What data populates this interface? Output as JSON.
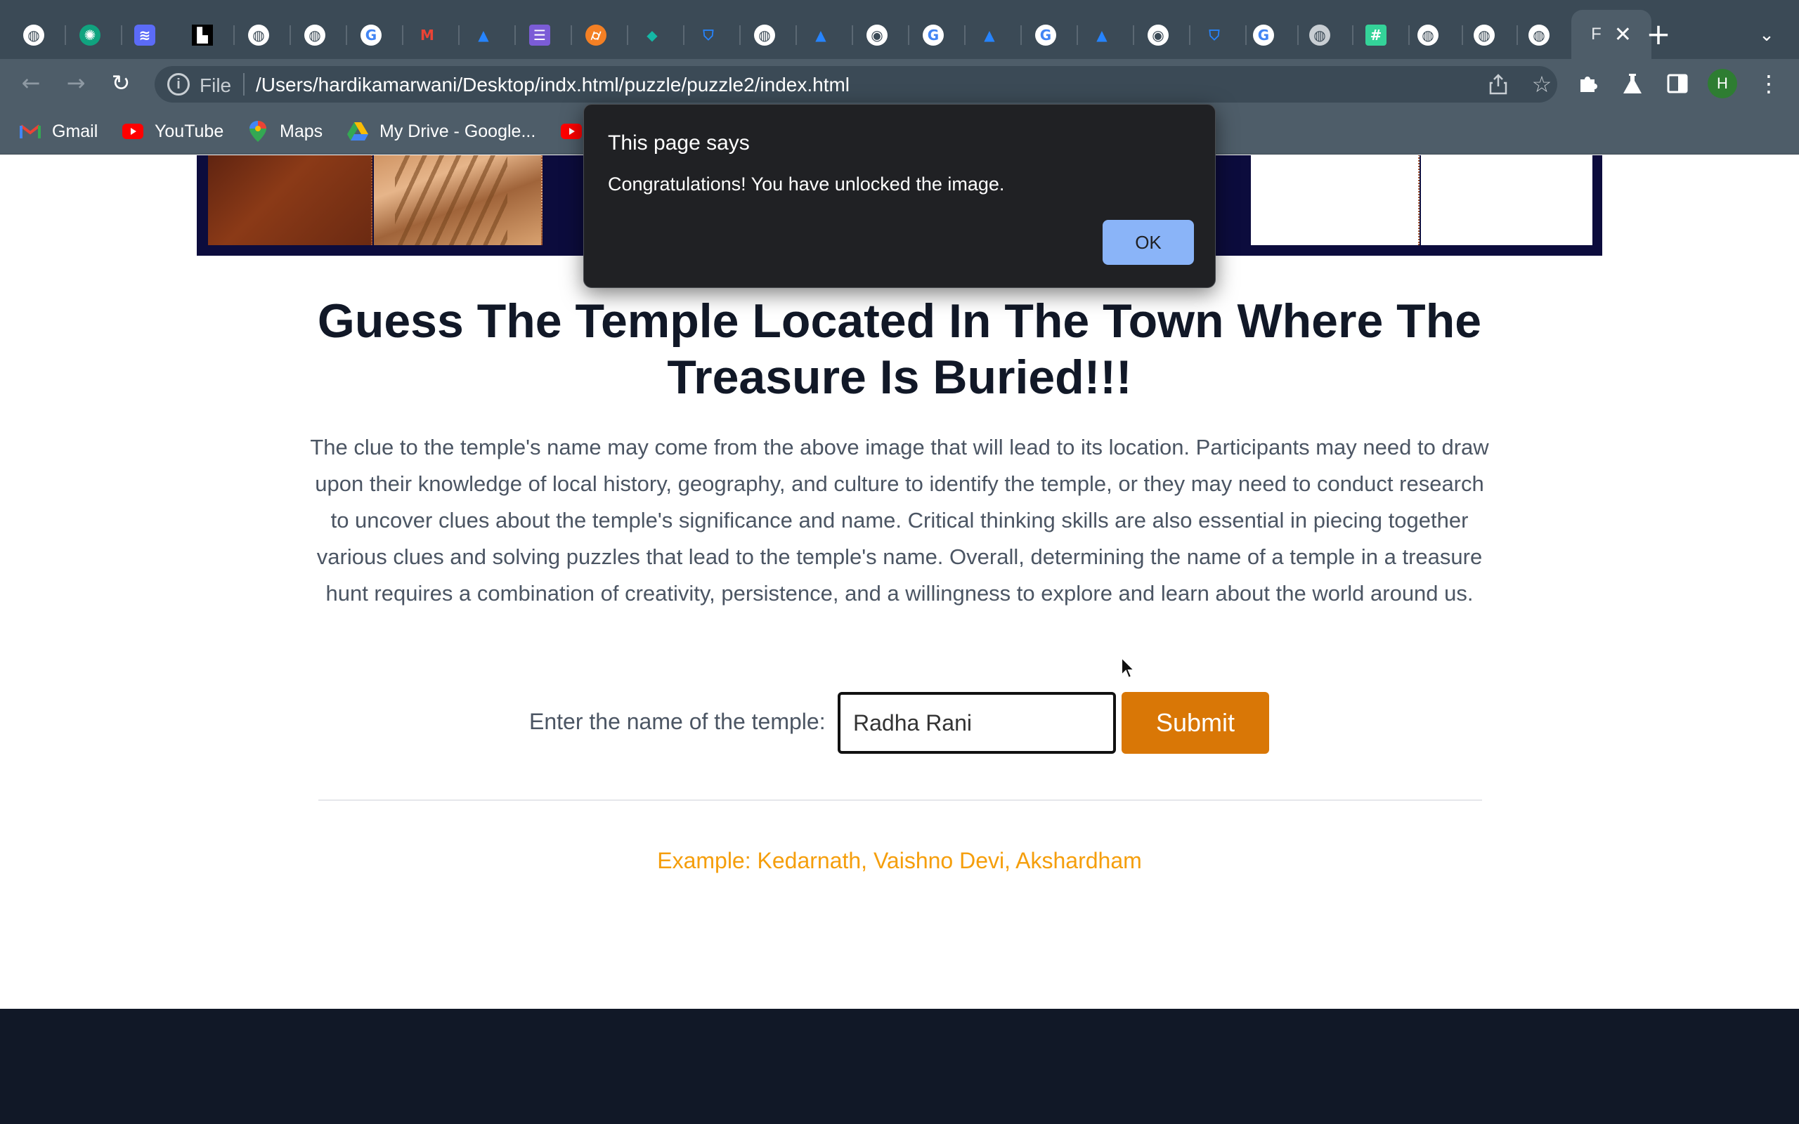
{
  "browser": {
    "active_tab_title": "F",
    "tabs": [
      {
        "icon": "globe-icon",
        "color": "#ffffff"
      },
      {
        "icon": "chatgpt-icon",
        "color": "#10a37f"
      },
      {
        "icon": "layers-app-icon",
        "color": "#5b6bf7"
      },
      {
        "icon": "unsplash-icon",
        "color": "#000000"
      },
      {
        "icon": "globe-icon",
        "color": "#ffffff"
      },
      {
        "icon": "globe-icon",
        "color": "#ffffff"
      },
      {
        "icon": "google-icon",
        "color": "#4285f4"
      },
      {
        "icon": "gmail-icon",
        "color": "#ea4335"
      },
      {
        "icon": "atlassian-icon",
        "color": "#2684ff"
      },
      {
        "icon": "list-app-icon",
        "color": "#7b5cd6"
      },
      {
        "icon": "stackoverflow-icon",
        "color": "#f48024"
      },
      {
        "icon": "diamond-app-icon",
        "color": "#14b8a6"
      },
      {
        "icon": "bitbucket-icon",
        "color": "#2684ff"
      },
      {
        "icon": "globe-icon",
        "color": "#ffffff"
      },
      {
        "icon": "atlassian-icon",
        "color": "#2684ff"
      },
      {
        "icon": "chrome-icon",
        "color": "#ffffff"
      },
      {
        "icon": "google-icon",
        "color": "#4285f4"
      },
      {
        "icon": "atlassian-icon",
        "color": "#2684ff"
      },
      {
        "icon": "google-icon",
        "color": "#4285f4"
      },
      {
        "icon": "atlassian-icon",
        "color": "#2684ff"
      },
      {
        "icon": "chrome-icon",
        "color": "#ffffff"
      },
      {
        "icon": "bitbucket-icon",
        "color": "#2684ff"
      },
      {
        "icon": "google-icon",
        "color": "#4285f4"
      },
      {
        "icon": "globe-icon",
        "color": "#c8ced3"
      },
      {
        "icon": "sheets-icon",
        "color": "#34d399"
      },
      {
        "icon": "globe-icon",
        "color": "#ffffff"
      },
      {
        "icon": "globe-icon",
        "color": "#ffffff"
      },
      {
        "icon": "globe-icon",
        "color": "#ffffff"
      }
    ],
    "address": {
      "scheme_label": "File",
      "url": "/Users/hardikamarwani/Desktop/indx.html/puzzle/puzzle2/index.html"
    },
    "profile_initial": "H",
    "bookmarks": [
      {
        "label": "Gmail",
        "icon": "gmail-icon"
      },
      {
        "label": "YouTube",
        "icon": "youtube-icon"
      },
      {
        "label": "Maps",
        "icon": "maps-icon"
      },
      {
        "label": "My Drive - Google...",
        "icon": "google-drive-icon"
      },
      {
        "label": "",
        "icon": "youtube-icon"
      }
    ]
  },
  "page": {
    "heading": "Guess The Temple Located In The Town Where The Treasure Is Buried!!!",
    "description": "The clue to the temple's name may come from the above image that will lead to its location. Participants may need to draw upon their knowledge of local history, geography, and culture to identify the temple, or they may need to conduct research to uncover clues about the temple's significance and name. Critical thinking skills are also essential in piecing together various clues and solving puzzles that lead to the temple's name. Overall, determining the name of a temple in a treasure hunt requires a combination of creativity, persistence, and a willingness to explore and learn about the world around us.",
    "form": {
      "label": "Enter the name of the temple:",
      "input_value": "Radha Rani",
      "submit_label": "Submit"
    },
    "example": "Example: Kedarnath, Vaishno Devi, Akshardham",
    "colors": {
      "accent": "#d97706",
      "example_text": "#f59e0b",
      "footer": "#111827"
    }
  },
  "alert": {
    "title": "This page says",
    "message": "Congratulations! You have unlocked the image.",
    "ok_label": "OK"
  }
}
